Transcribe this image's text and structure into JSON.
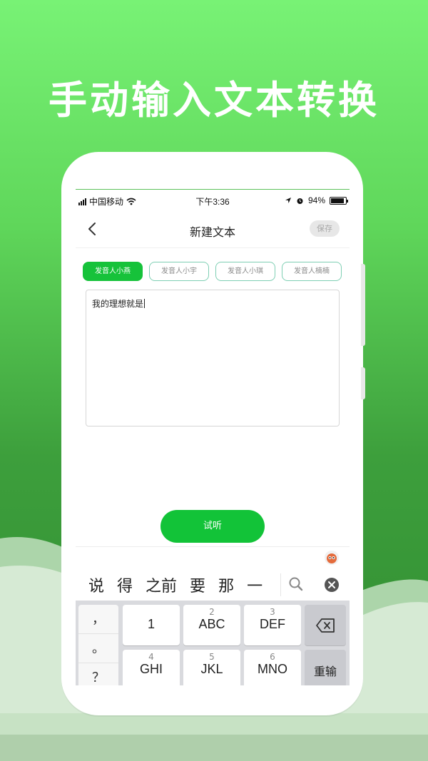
{
  "hero": {
    "title": "手动输入文本转换"
  },
  "status_bar": {
    "carrier": "中国移动",
    "time": "下午3:36",
    "battery": "94%"
  },
  "nav": {
    "title": "新建文本",
    "save_label": "保存"
  },
  "voices": [
    {
      "label": "发音人小燕",
      "active": true
    },
    {
      "label": "发音人小宇",
      "active": false
    },
    {
      "label": "发音人小琪",
      "active": false
    },
    {
      "label": "发音人楠楠",
      "active": false
    }
  ],
  "editor": {
    "text": "我的理想就是"
  },
  "listen_button": {
    "label": "试听"
  },
  "candidates": [
    "说",
    "得",
    "之前",
    "要",
    "那",
    "一"
  ],
  "keyboard": {
    "punctuation": [
      "，",
      "。",
      "？"
    ],
    "keys": [
      {
        "num": "",
        "label": "1"
      },
      {
        "num": "2",
        "label": "ABC"
      },
      {
        "num": "3",
        "label": "DEF"
      },
      {
        "num": "4",
        "label": "GHI"
      },
      {
        "num": "5",
        "label": "JKL"
      },
      {
        "num": "6",
        "label": "MNO"
      }
    ],
    "reenter_label": "重输"
  },
  "colors": {
    "brand_green": "#12c338",
    "background_top": "#78f275",
    "background_bottom": "#2f8a30"
  }
}
